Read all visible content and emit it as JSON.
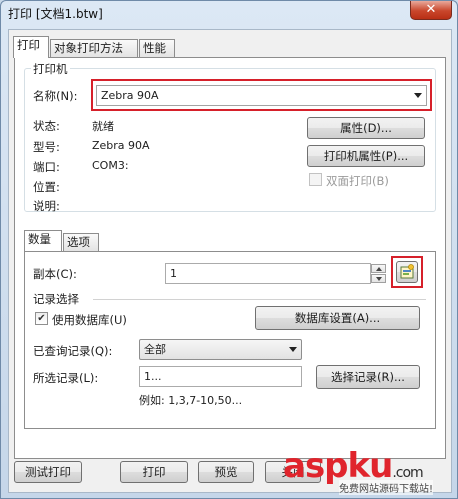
{
  "window": {
    "title": "打印 [文档1.btw]",
    "close_glyph": "✕"
  },
  "tabs": [
    {
      "label": "打印",
      "active": true
    },
    {
      "label": "对象打印方法",
      "active": false
    },
    {
      "label": "性能",
      "active": false
    }
  ],
  "printer": {
    "group_title": "打印机",
    "name_label": "名称(N):",
    "name_value": "Zebra 90A",
    "status_label": "状态:",
    "status_value": "就绪",
    "model_label": "型号:",
    "model_value": "Zebra 90A",
    "port_label": "端口:",
    "port_value": "COM3:",
    "location_label": "位置:",
    "comment_label": "说明:",
    "properties_button": "属性(D)...",
    "printer_properties_button": "打印机属性(P)...",
    "duplex_label": "双面打印(B)",
    "duplex_checked": false
  },
  "subtabs": [
    {
      "label": "数量",
      "active": true
    },
    {
      "label": "选项",
      "active": false
    }
  ],
  "quantity": {
    "copies_label": "副本(C):",
    "copies_value": "1",
    "record_group_title": "记录选择",
    "use_database_label": "使用数据库(U)",
    "use_database_checked": true,
    "database_setup_button": "数据库设置(A)...",
    "queried_records_label": "已查询记录(Q):",
    "queried_records_value": "全部",
    "selected_records_label": "所选记录(L):",
    "selected_records_value": "1...",
    "select_records_button": "选择记录(R)...",
    "example_text": "例如: 1,3,7-10,50..."
  },
  "footer": {
    "test_print_button": "测试打印",
    "print_button": "打印",
    "preview_button": "预览",
    "close_button": "关闭"
  },
  "watermark": {
    "brand": "aspku",
    "brand_suffix": ".com",
    "tagline": "免费网站源码下载站!"
  },
  "colors": {
    "highlight": "#d6202a",
    "close_button": "#c9462b"
  }
}
